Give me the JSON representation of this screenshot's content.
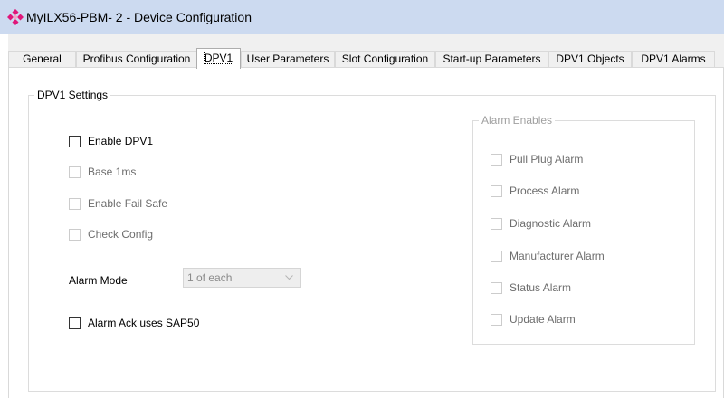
{
  "window": {
    "title": "MyILX56-PBM- 2 - Device Configuration",
    "icon": "device-config-icon",
    "icon_color": "#e0167a"
  },
  "tabs": [
    {
      "label": "General",
      "active": false
    },
    {
      "label": "Profibus Configuration",
      "active": false
    },
    {
      "label": "DPV1",
      "active": true
    },
    {
      "label": "User Parameters",
      "active": false
    },
    {
      "label": "Slot Configuration",
      "active": false
    },
    {
      "label": "Start-up Parameters",
      "active": false
    },
    {
      "label": "DPV1 Objects",
      "active": false
    },
    {
      "label": "DPV1 Alarms",
      "active": false
    }
  ],
  "dpv1_settings": {
    "legend": "DPV1 Settings",
    "checkboxes": [
      {
        "label": "Enable DPV1",
        "checked": false,
        "enabled": true
      },
      {
        "label": "Base 1ms",
        "checked": false,
        "enabled": false
      },
      {
        "label": "Enable Fail Safe",
        "checked": false,
        "enabled": false
      },
      {
        "label": "Check Config",
        "checked": false,
        "enabled": false
      }
    ],
    "alarm_mode": {
      "label": "Alarm Mode",
      "selected": "1 of each",
      "enabled": false
    },
    "alarm_ack": {
      "label": "Alarm Ack uses SAP50",
      "checked": false,
      "enabled": true
    }
  },
  "alarm_enables": {
    "legend": "Alarm Enables",
    "enabled": false,
    "checkboxes": [
      {
        "label": "Pull Plug Alarm",
        "checked": false
      },
      {
        "label": "Process Alarm",
        "checked": false
      },
      {
        "label": "Diagnostic Alarm",
        "checked": false
      },
      {
        "label": "Manufacturer Alarm",
        "checked": false
      },
      {
        "label": "Status Alarm",
        "checked": false
      },
      {
        "label": "Update Alarm",
        "checked": false
      }
    ]
  }
}
